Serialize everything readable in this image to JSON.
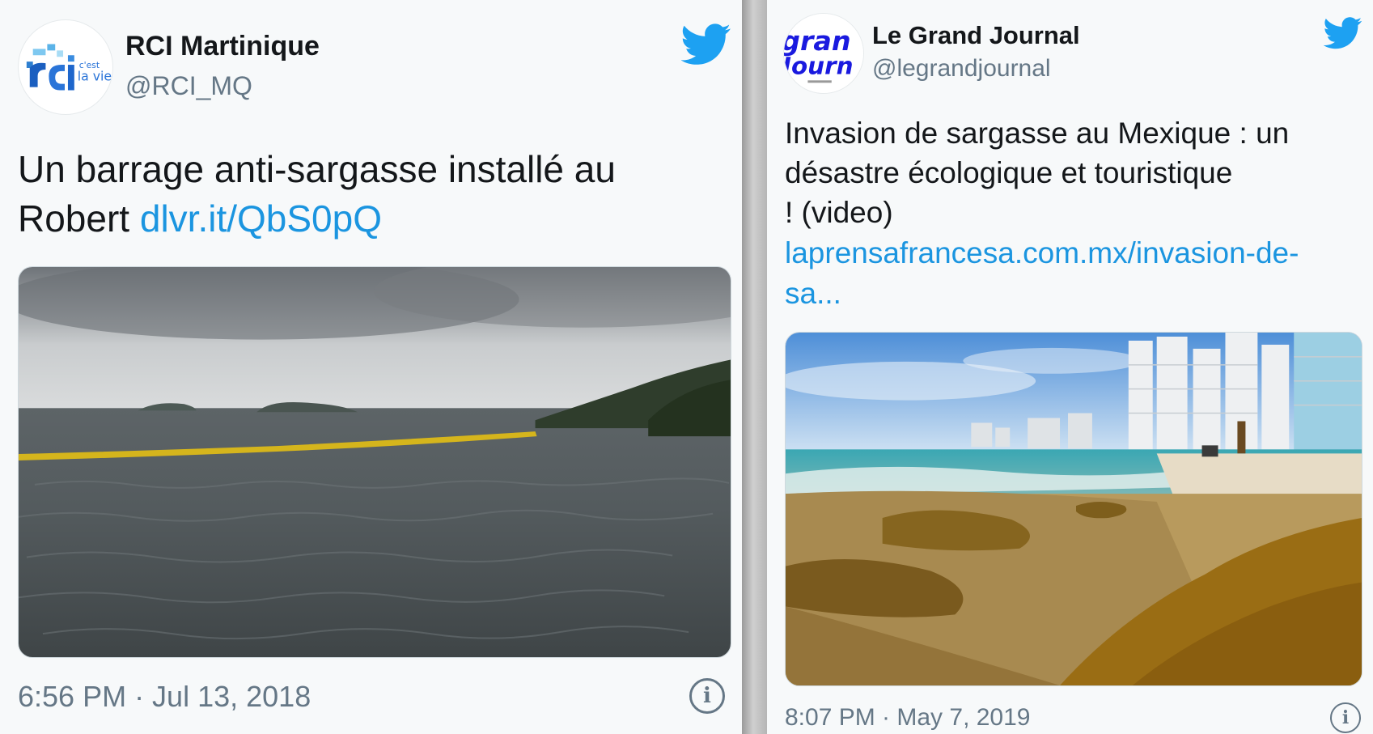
{
  "colors": {
    "link": "#1b95e0",
    "bird": "#1da1f2",
    "text": "#14171a",
    "secondary": "#657786",
    "background": "#f7f9fa"
  },
  "tweets": [
    {
      "name": "RCI Martinique",
      "handle": "@RCI_MQ",
      "avatar_logo": {
        "mark": "rci",
        "tagline_1": "c'est",
        "tagline_2": "la vie"
      },
      "text": "Un barrage anti-sargasse installé au",
      "text_line_2": "Robert ",
      "link": "dlvr.it/QbS0pQ",
      "timestamp": "6:56 PM · Jul 13, 2018",
      "icons": {
        "brand": "twitter-bird-icon",
        "info": "info-icon"
      }
    },
    {
      "name": "Le Grand Journal",
      "handle": "@legrandjournal",
      "avatar_logo": {
        "word_1": "gran",
        "word_2": "Journ"
      },
      "text_lines": [
        "Invasion de sargasse au Mexique : un",
        "désastre écologique et touristique",
        "! (video)"
      ],
      "link_lines": [
        "laprensafrancesa.com.mx/invasion-de-",
        "sa..."
      ],
      "timestamp": "8:07 PM · May 7, 2019",
      "icons": {
        "brand": "twitter-bird-icon",
        "info": "info-icon"
      }
    }
  ]
}
